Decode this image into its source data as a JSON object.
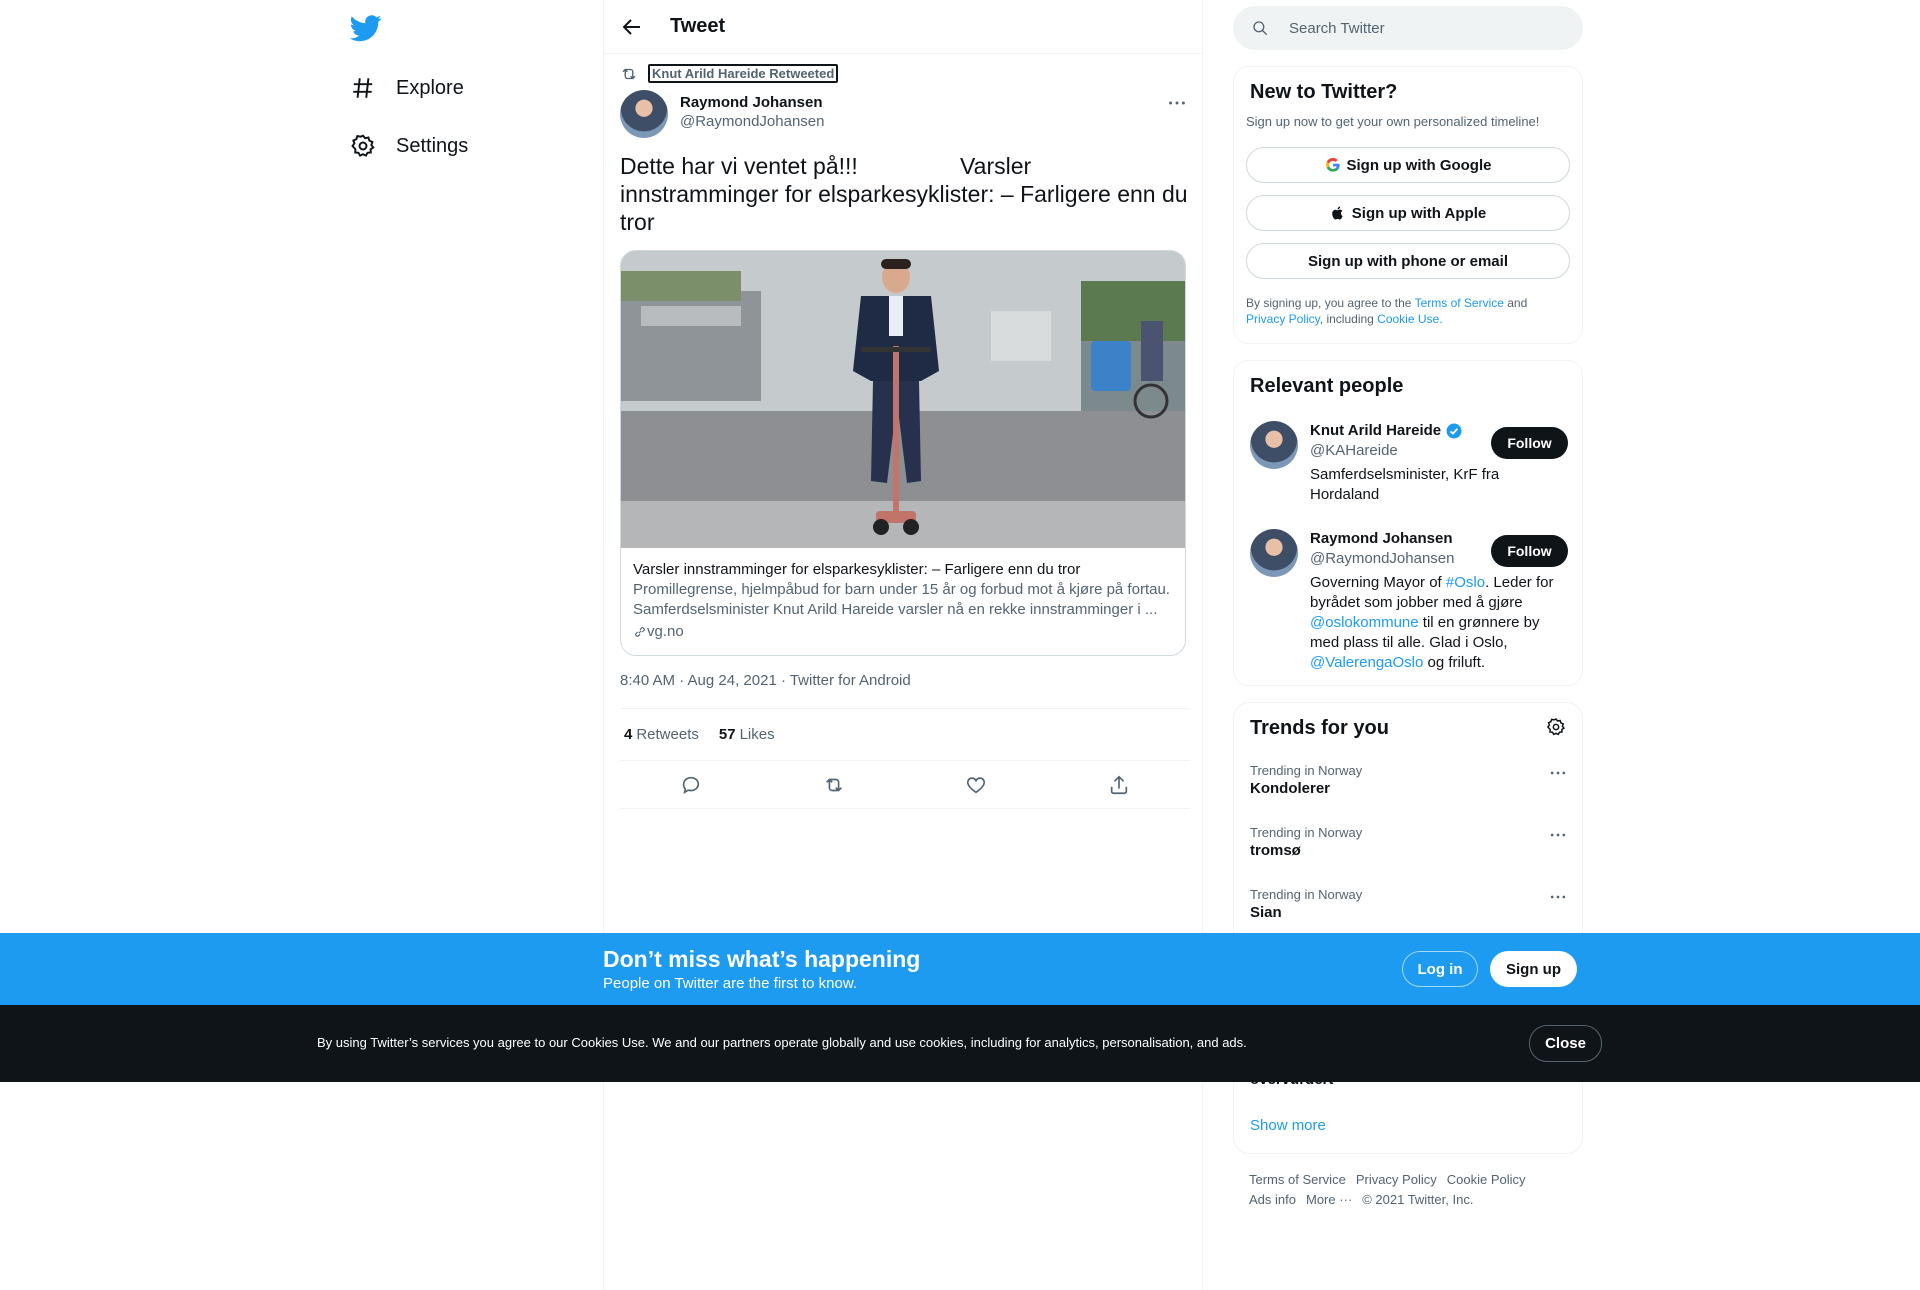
{
  "nav": {
    "explore": "Explore",
    "settings": "Settings"
  },
  "header": {
    "title": "Tweet"
  },
  "tweet": {
    "retweeted_by": "Knut Arild Hareide Retweeted",
    "author_name": "Raymond Johansen",
    "author_handle": "@RaymondJohansen",
    "text": "Dette har vi ventet på!!!                Varsler innstramminger for elsparkesyklister: – Farligere enn du tror",
    "card": {
      "title": "Varsler innstramminger for elsparkesyklister: – Farligere enn du tror",
      "description": "Promillegrense, hjelmpåbud for barn under 15 år og forbud mot å kjøre på fortau. Samferdselsminister Knut Arild Hareide varsler nå en rekke innstramminger i ...",
      "domain": "vg.no"
    },
    "meta": "8:40 AM · Aug 24, 2021 · Twitter for Android",
    "retweets_count": "4",
    "retweets_label": "Retweets",
    "likes_count": "57",
    "likes_label": "Likes"
  },
  "search": {
    "placeholder": "Search Twitter"
  },
  "signup_box": {
    "title": "New to Twitter?",
    "subtitle": "Sign up now to get your own personalized timeline!",
    "google": "Sign up with Google",
    "apple": "Sign up with Apple",
    "phone": "Sign up with phone or email",
    "legal_prefix": "By signing up, you agree to the ",
    "terms": "Terms of Service",
    "and": " and",
    "privacy": "Privacy Policy",
    "including": ", including ",
    "cookie": "Cookie Use."
  },
  "relevant": {
    "title": "Relevant people",
    "people": [
      {
        "name": "Knut Arild Hareide",
        "handle": "@KAHareide",
        "follow": "Follow",
        "bio": "Samferdselsminister, KrF fra Hordaland"
      },
      {
        "name": "Raymond Johansen",
        "handle": "@RaymondJohansen",
        "follow": "Follow",
        "bio_1": "Governing Mayor of ",
        "bio_link1": "#Oslo",
        "bio_2": ". Leder for byrådet som jobber med å gjøre ",
        "bio_link2": "@oslokommune",
        "bio_3": " til en grønnere by med plass til alle. Glad i Oslo, ",
        "bio_link3": "@ValerengaOslo",
        "bio_4": " og friluft."
      }
    ]
  },
  "trends": {
    "title": "Trends for you",
    "items": [
      {
        "context": "Trending in Norway",
        "name": "Kondolerer"
      },
      {
        "context": "Trending in Norway",
        "name": "tromsø"
      },
      {
        "context": "Trending in Norway",
        "name": "Sian"
      }
    ],
    "partial_name": "overvurdert",
    "show_more": "Show more"
  },
  "footer": {
    "terms": "Terms of Service",
    "privacy": "Privacy Policy",
    "cookie": "Cookie Policy",
    "ads": "Ads info",
    "more": "More ···",
    "copyright": "© 2021 Twitter, Inc."
  },
  "banner": {
    "title": "Don’t miss what’s happening",
    "subtitle": "People on Twitter are the first to know.",
    "login": "Log in",
    "signup": "Sign up"
  },
  "cookies": {
    "text": "By using Twitter’s services you agree to our Cookies Use. We and our partners operate globally and use cookies, including for analytics, personalisation, and ads.",
    "close": "Close"
  },
  "colors": {
    "accent": "#1d9bf0",
    "text": "#0f1419",
    "secondary": "#536471"
  }
}
